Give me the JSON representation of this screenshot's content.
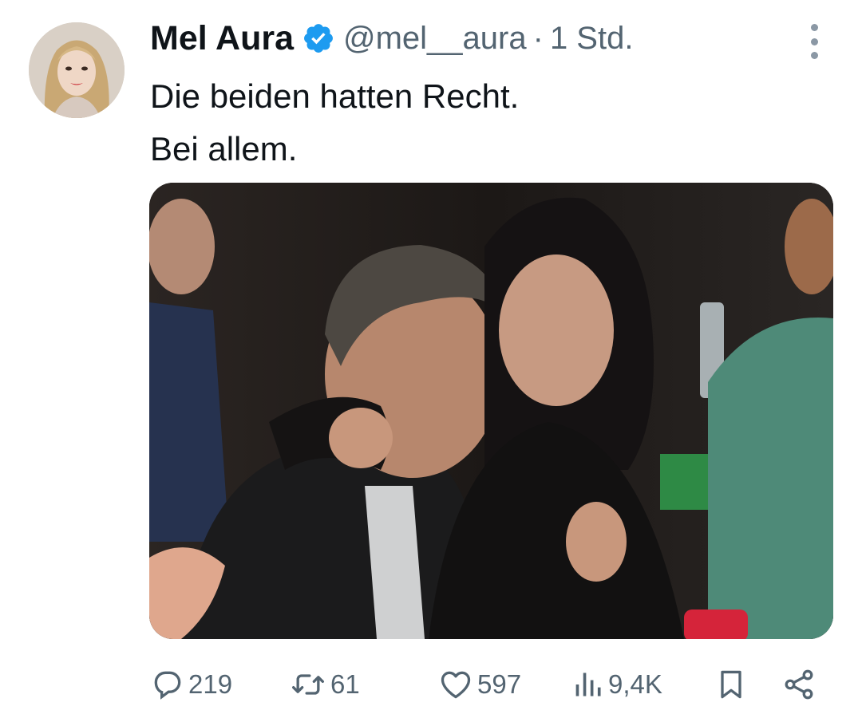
{
  "tweet": {
    "author": {
      "name": "Mel Aura",
      "handle": "@mel__aura",
      "verified": true,
      "avatar_icon": "user-avatar-photo"
    },
    "separator": "·",
    "time": "1 Std.",
    "text_lines": [
      "Die beiden hatten Recht.",
      "Bei allem."
    ],
    "media": {
      "type": "photo",
      "icon": "tweet-photo"
    },
    "actions": {
      "replies": "219",
      "retweets": "61",
      "likes": "597",
      "views": "9,4K"
    }
  },
  "colors": {
    "text_primary": "#0f1419",
    "text_secondary": "#536471",
    "verified_blue": "#1d9bf0"
  },
  "icons": {
    "more": "more-vertical-icon",
    "reply": "reply-icon",
    "retweet": "retweet-icon",
    "like": "heart-icon",
    "views": "views-icon",
    "bookmark": "bookmark-icon",
    "share": "share-icon"
  }
}
